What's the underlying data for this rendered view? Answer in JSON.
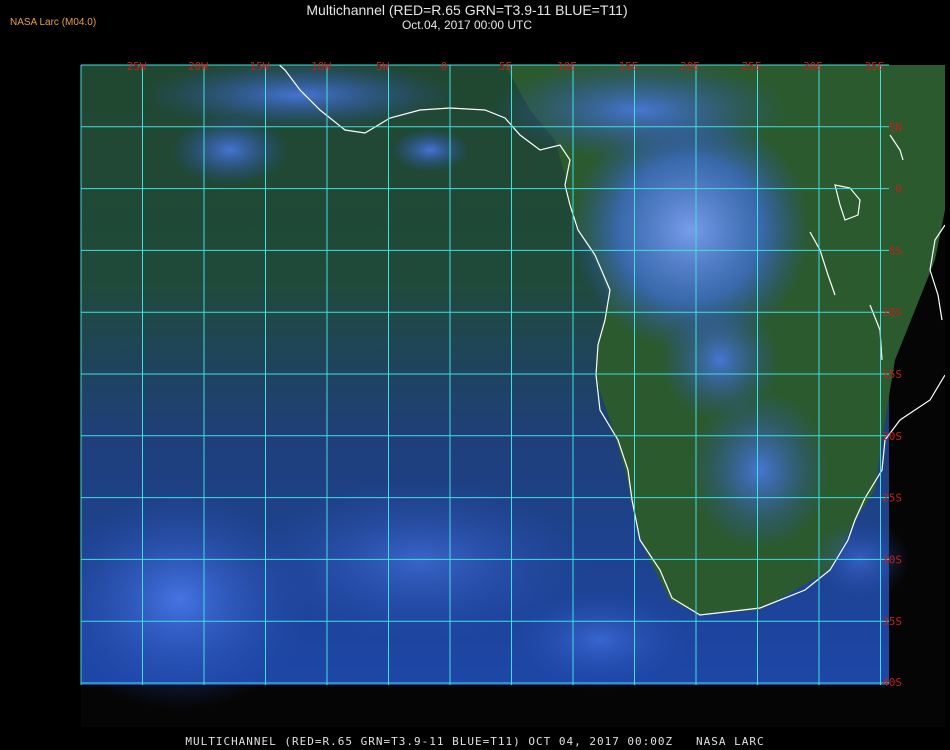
{
  "header": {
    "brand": "NASA Larc (M04.0)",
    "title": "Multichannel (RED=R.65 GRN=T3.9-11 BLUE=T11)",
    "subtitle": "Oct.04, 2017 00:00 UTC"
  },
  "map": {
    "lon_labels": [
      "25W",
      "20W",
      "15W",
      "10W",
      "5W",
      "0",
      "5E",
      "10E",
      "15E",
      "20E",
      "25E",
      "30E",
      "35E"
    ],
    "lat_labels": [
      "5N",
      "0",
      "5S",
      "10S",
      "15S",
      "20S",
      "25S",
      "30S",
      "35S",
      "40S"
    ],
    "grid_color": "#3fe0e0",
    "label_color": "#c0201e",
    "coast_color": "#ffffff",
    "colors": {
      "ocean": "#234a33",
      "ocean_south": "#1c3d8a",
      "cloud": "#3f72e6",
      "cloud_bright": "#8fb0ff"
    }
  },
  "footer": {
    "text": "MULTICHANNEL (RED=R.65 GRN=T3.9-11 BLUE=T11) OCT 04, 2017 00:00Z   NASA LARC"
  }
}
